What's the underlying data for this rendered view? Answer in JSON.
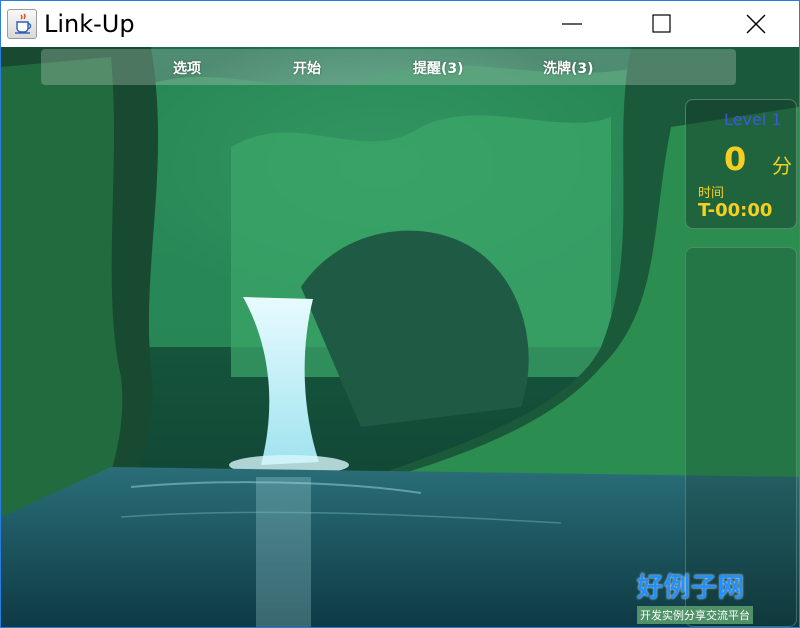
{
  "window": {
    "title": "Link-Up"
  },
  "menu": {
    "items": [
      "选项",
      "开始",
      "提醒(3)",
      "洗牌(3)"
    ]
  },
  "status": {
    "level": "Level 1",
    "score": "0",
    "score_unit": "分",
    "time_label": "时间",
    "time_value": "T-00:00"
  },
  "watermark": {
    "main": "好例子网",
    "sub": "开发实例分享交流平台"
  },
  "colors": {
    "accent_blue": "#3a5bd9",
    "score_yellow": "#f5d020",
    "watermark_blue": "#1e90ff"
  },
  "icons": {
    "app": "java-cup-icon",
    "minimize": "minimize-icon",
    "maximize": "maximize-icon",
    "close": "close-icon"
  }
}
